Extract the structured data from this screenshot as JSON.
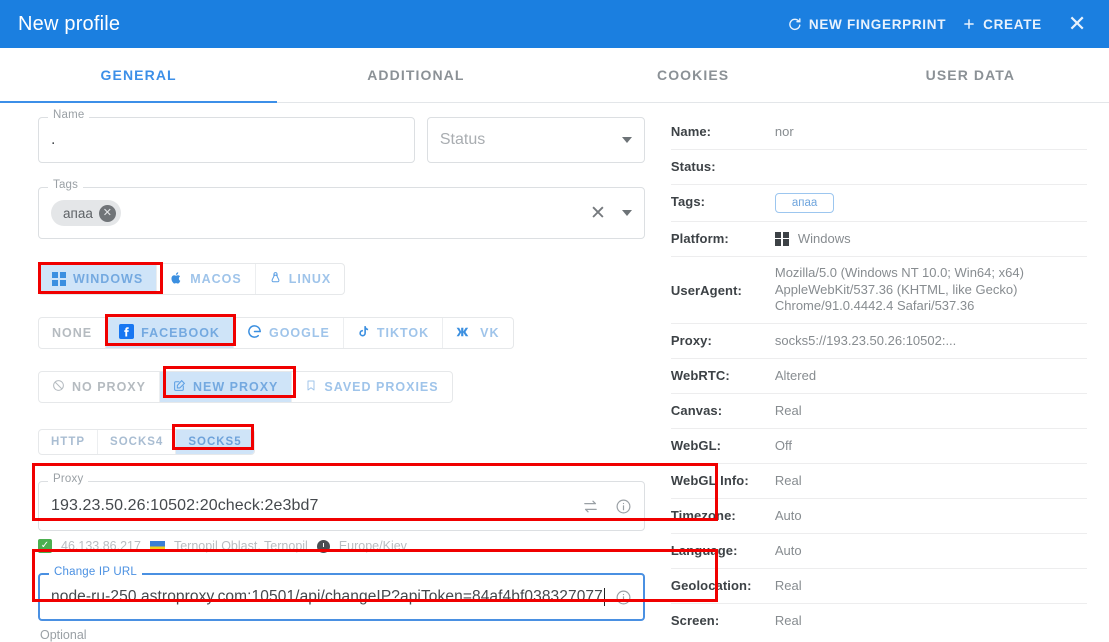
{
  "titlebar": {
    "title": "New profile",
    "new_fingerprint_label": "NEW FINGERPRINT",
    "new_fingerprint_icon": "refresh-icon",
    "create_label": "CREATE",
    "create_icon": "plus-icon",
    "close_icon": "close-icon",
    "bg_color": "#1b7fe0"
  },
  "tabs": [
    {
      "label": "GENERAL",
      "active": true
    },
    {
      "label": "ADDITIONAL",
      "active": false
    },
    {
      "label": "COOKIES",
      "active": false
    },
    {
      "label": "USER DATA",
      "active": false
    }
  ],
  "form": {
    "name": {
      "legend": "Name",
      "value": ".",
      "placeholder": ""
    },
    "status": {
      "placeholder": "Status",
      "value": "",
      "caret_icon": "chevron-down-icon"
    },
    "tags": {
      "legend": "Tags",
      "chips": [
        {
          "label": "апаа",
          "remove_icon": "chip-remove-icon"
        }
      ],
      "clear_icon": "clear-x-icon",
      "caret_icon": "chevron-down-icon"
    },
    "os_group": [
      {
        "label": "WINDOWS",
        "icon": "windows-icon",
        "selected": true,
        "highlighted": true
      },
      {
        "label": "MACOS",
        "icon": "apple-icon",
        "selected": false,
        "highlighted": false
      },
      {
        "label": "LINUX",
        "icon": "linux-icon",
        "selected": false,
        "highlighted": false
      }
    ],
    "social_group": [
      {
        "label": "NONE",
        "icon": "",
        "selected": false,
        "highlighted": false
      },
      {
        "label": "FACEBOOK",
        "icon": "facebook-icon",
        "selected": true,
        "highlighted": true
      },
      {
        "label": "GOOGLE",
        "icon": "google-icon",
        "selected": false,
        "highlighted": false
      },
      {
        "label": "TIKTOK",
        "icon": "tiktok-icon",
        "selected": false,
        "highlighted": false
      },
      {
        "label": "VK",
        "icon": "vk-icon",
        "selected": false,
        "highlighted": false
      }
    ],
    "proxy_mode_group": [
      {
        "label": "NO PROXY",
        "icon": "no-proxy-icon",
        "selected": false,
        "highlighted": false
      },
      {
        "label": "NEW PROXY",
        "icon": "edit-square-icon",
        "selected": true,
        "highlighted": true
      },
      {
        "label": "SAVED PROXIES",
        "icon": "bookmark-icon",
        "selected": false,
        "highlighted": false
      }
    ],
    "protocol_group": [
      {
        "label": "HTTP",
        "selected": false,
        "highlighted": false
      },
      {
        "label": "SOCKS4",
        "selected": false,
        "highlighted": false
      },
      {
        "label": "SOCKS5",
        "selected": true,
        "highlighted": true
      }
    ],
    "proxy": {
      "legend": "Proxy",
      "value": "193.23.50.26:10502:20check:2e3bd7",
      "swap_icon": "swap-arrows-icon",
      "info_icon": "info-circle-icon",
      "highlighted": true
    },
    "proxy_status": {
      "check_icon": "checkmark-icon",
      "ip": "46.133.86.217",
      "flag_icon": "ukraine-flag-icon",
      "location": "Ternopil Oblast, Ternopil",
      "clock_icon": "clock-icon",
      "timezone": "Europe/Kiev"
    },
    "change_ip_url": {
      "legend": "Change IP URL",
      "value": "node-ru-250.astroproxy.com:10501/api/changeIP?apiToken=84af4bf038327077",
      "info_icon": "info-circle-icon",
      "hint": "Optional",
      "focused": true,
      "highlighted": true
    }
  },
  "info_panel": {
    "rows": [
      {
        "key": "Name:",
        "value": "nor",
        "type": "text"
      },
      {
        "key": "Status:",
        "value": "",
        "type": "text"
      },
      {
        "key": "Tags:",
        "value": "апаа",
        "type": "tag"
      },
      {
        "key": "Platform:",
        "value": "Windows",
        "type": "platform",
        "icon": "windows-icon"
      },
      {
        "key": "UserAgent:",
        "value": "Mozilla/5.0 (Windows NT 10.0; Win64; x64) AppleWebKit/537.36 (KHTML, like Gecko) Chrome/91.0.4442.4 Safari/537.36",
        "type": "text"
      },
      {
        "key": "Proxy:",
        "value": "socks5://193.23.50.26:10502:...",
        "type": "text"
      },
      {
        "key": "WebRTC:",
        "value": "Altered",
        "type": "text"
      },
      {
        "key": "Canvas:",
        "value": "Real",
        "type": "text"
      },
      {
        "key": "WebGL:",
        "value": "Off",
        "type": "text"
      },
      {
        "key": "WebGL Info:",
        "value": "Real",
        "type": "text"
      },
      {
        "key": "Timezone:",
        "value": "Auto",
        "type": "text"
      },
      {
        "key": "Language:",
        "value": "Auto",
        "type": "text"
      },
      {
        "key": "Geolocation:",
        "value": "Real",
        "type": "text"
      },
      {
        "key": "Screen:",
        "value": "Real",
        "type": "text"
      }
    ]
  },
  "colors": {
    "brand_blue": "#1b7fe0",
    "accent_blue": "#3c8fe8",
    "selected_chip_bg": "#cfe4f8",
    "annotation_red": "#f00000"
  }
}
